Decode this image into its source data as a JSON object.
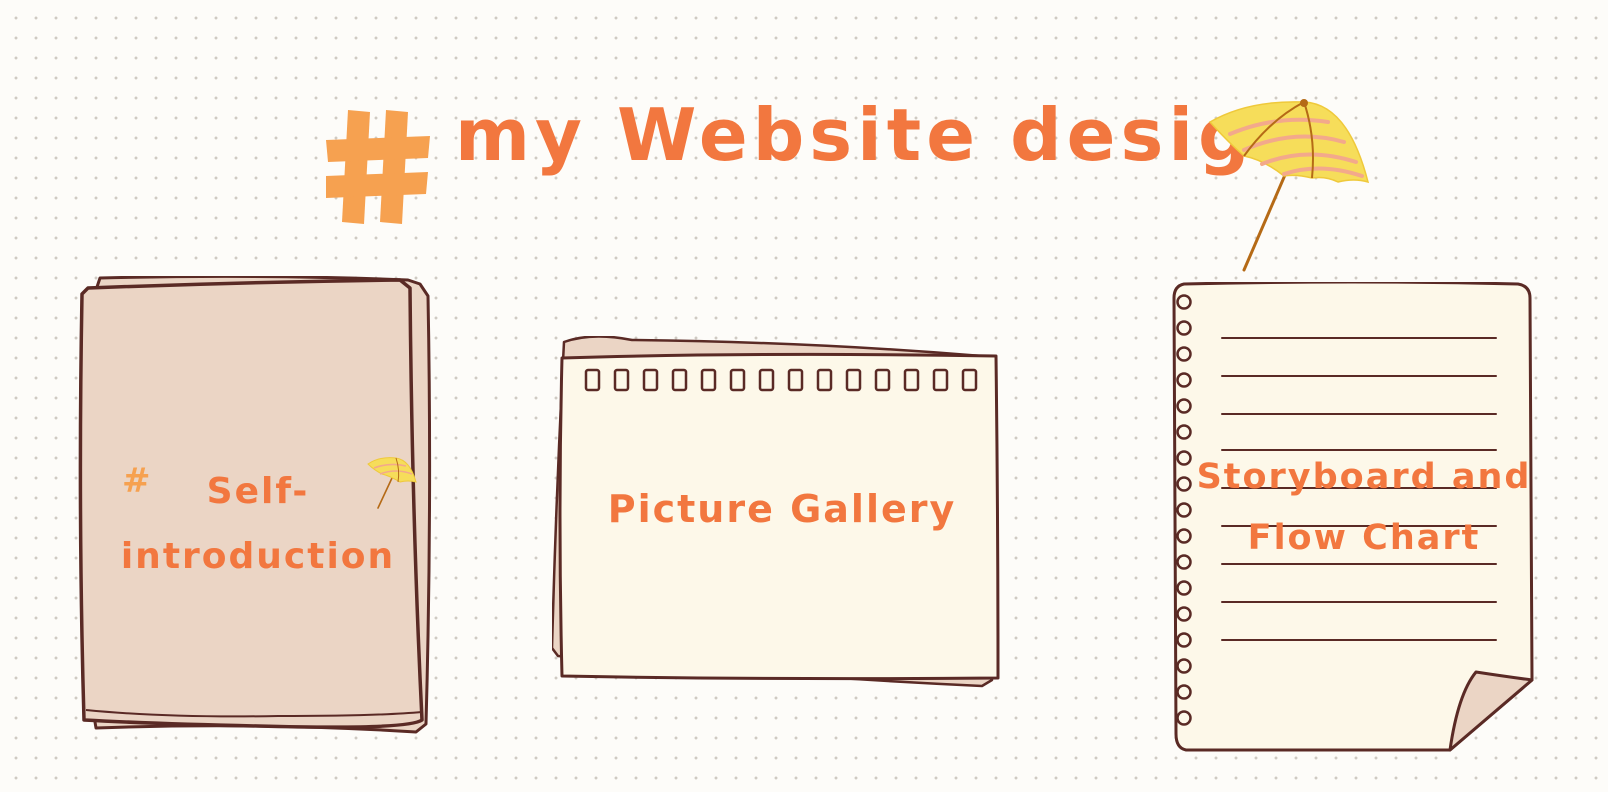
{
  "title": {
    "hash_symbol": "#",
    "text": "my Website design"
  },
  "cards": [
    {
      "id": "self-introduction",
      "label": "Self-introduction",
      "line1": "Self-",
      "line2": "introduction",
      "hash_symbol": "#"
    },
    {
      "id": "picture-gallery",
      "label": "Picture Gallery"
    },
    {
      "id": "storyboard",
      "line1": "Storyboard and",
      "line2": "Flow Chart"
    }
  ],
  "icons": {
    "title_hash": "hash-icon",
    "title_umbrella": "umbrella-icon",
    "card_hash": "hash-icon",
    "card_umbrella": "umbrella-icon"
  },
  "colors": {
    "title_text": "#f2773f",
    "hash": "#f6a150",
    "outline": "#5a2a25",
    "card_tan": "#ebd5c5",
    "card_cream": "#fdf8e9",
    "umbrella_yellow": "#f6dd5a",
    "umbrella_stripe": "#f3a98b",
    "background": "#fdfcf9"
  }
}
